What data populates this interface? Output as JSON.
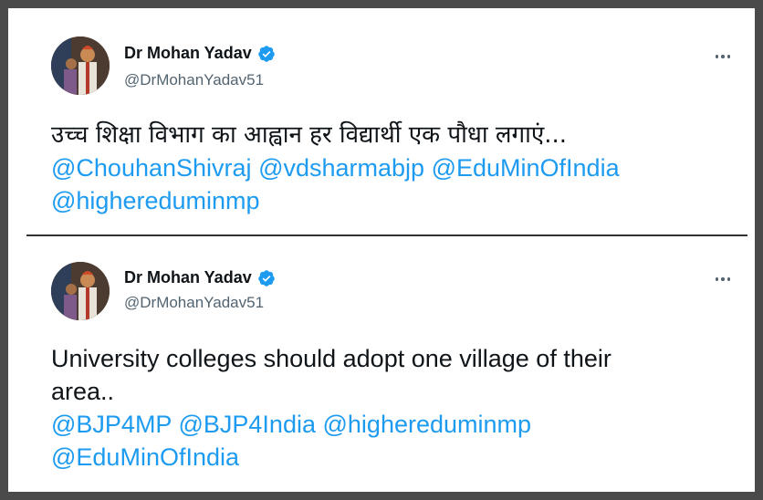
{
  "tweets": [
    {
      "author_name": "Dr Mohan Yadav",
      "handle": "@DrMohanYadav51",
      "text_line": "उच्च शिक्षा विभाग का आह्वान हर विद्यार्थी एक पौधा लगाएं...",
      "mentions_line1": [
        "@ChouhanShivraj",
        "@vdsharmabjp",
        "@EduMinOfIndia"
      ],
      "mentions_line2": [
        "@highereduminmp"
      ]
    },
    {
      "author_name": "Dr Mohan Yadav",
      "handle": "@DrMohanYadav51",
      "text_line1": "University colleges should adopt one village of their",
      "text_line2": "area..",
      "mentions_line1": [
        "@BJP4MP",
        "@BJP4India",
        "@highereduminmp"
      ],
      "mentions_line2": [
        "@EduMinOfIndia"
      ]
    }
  ],
  "colors": {
    "text": "#0f1419",
    "secondary": "#536471",
    "link": "#1d9bf0",
    "verified": "#1d9bf0",
    "frame": "#4a4a4a"
  },
  "icons": [
    "verified-badge-icon",
    "more-options-icon"
  ]
}
